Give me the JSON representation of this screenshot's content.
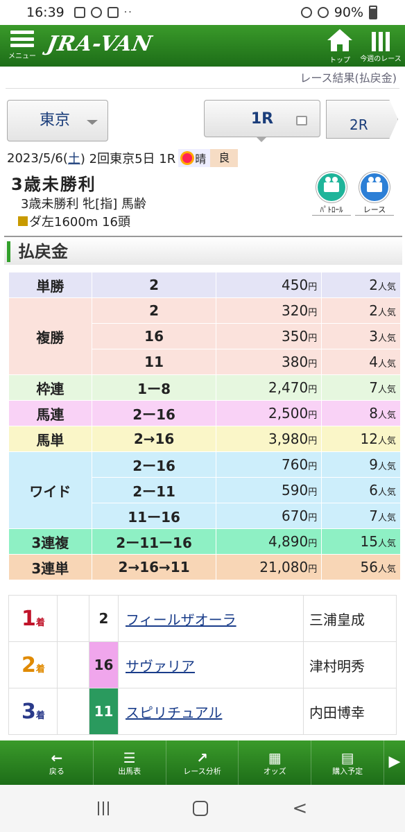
{
  "status": {
    "time": "16:39",
    "battery": "90%",
    "dots": "··"
  },
  "app": {
    "menu_label": "メニュー",
    "logo": "JRA-VAN",
    "top_label": "トップ",
    "week_label": "今週のレース"
  },
  "breadcrumb": "レース結果(払戻金)",
  "venue": "東京",
  "race_tabs": {
    "current": "1R",
    "next": "2R"
  },
  "race_info": {
    "date": "2023/5/6(",
    "weekday": "土",
    "date_tail": ") 2回東京5日 1R",
    "weather": "晴",
    "condition": "良"
  },
  "race": {
    "name": "3歳未勝利",
    "subtitle": "3歳未勝利 牝[指] 馬齢",
    "course": "ダ左1600m 16頭"
  },
  "videos": {
    "patrol_label": "ﾊﾟﾄﾛｰﾙ",
    "race_label": "レース"
  },
  "section_title": "払戻金",
  "payouts": [
    {
      "type": "単勝",
      "rows": [
        {
          "num": "2",
          "amount": "450",
          "pop": "2"
        }
      ]
    },
    {
      "type": "複勝",
      "rows": [
        {
          "num": "2",
          "amount": "320",
          "pop": "2"
        },
        {
          "num": "16",
          "amount": "350",
          "pop": "3"
        },
        {
          "num": "11",
          "amount": "380",
          "pop": "4"
        }
      ]
    },
    {
      "type": "枠連",
      "rows": [
        {
          "num": "1ー8",
          "amount": "2,470",
          "pop": "7"
        }
      ]
    },
    {
      "type": "馬連",
      "rows": [
        {
          "num": "2ー16",
          "amount": "2,500",
          "pop": "8"
        }
      ]
    },
    {
      "type": "馬単",
      "rows": [
        {
          "num": "2→16",
          "amount": "3,980",
          "pop": "12"
        }
      ]
    },
    {
      "type": "ワイド",
      "rows": [
        {
          "num": "2ー16",
          "amount": "760",
          "pop": "9"
        },
        {
          "num": "2ー11",
          "amount": "590",
          "pop": "6"
        },
        {
          "num": "11ー16",
          "amount": "670",
          "pop": "7"
        }
      ]
    },
    {
      "type": "3連複",
      "rows": [
        {
          "num": "2ー11ー16",
          "amount": "4,890",
          "pop": "15"
        }
      ]
    },
    {
      "type": "3連単",
      "rows": [
        {
          "num": "2→16→11",
          "amount": "21,080",
          "pop": "56"
        }
      ]
    }
  ],
  "units": {
    "yen": "円",
    "popular": "人気",
    "place": "着"
  },
  "results": [
    {
      "rank": "1",
      "num": "2",
      "horse": "フィールザオーラ",
      "jockey": "三浦皇成"
    },
    {
      "rank": "2",
      "num": "16",
      "horse": "サヴァリア",
      "jockey": "津村明秀"
    },
    {
      "rank": "3",
      "num": "11",
      "horse": "スピリチュアル",
      "jockey": "内田博幸"
    }
  ],
  "bottom_nav": [
    {
      "icon": "←",
      "label": "戻る"
    },
    {
      "icon": "☰",
      "label": "出馬表"
    },
    {
      "icon": "↗",
      "label": "レース分析"
    },
    {
      "icon": "▦",
      "label": "オッズ"
    },
    {
      "icon": "▤",
      "label": "購入予定"
    }
  ],
  "bottom_nav_more": "▶"
}
